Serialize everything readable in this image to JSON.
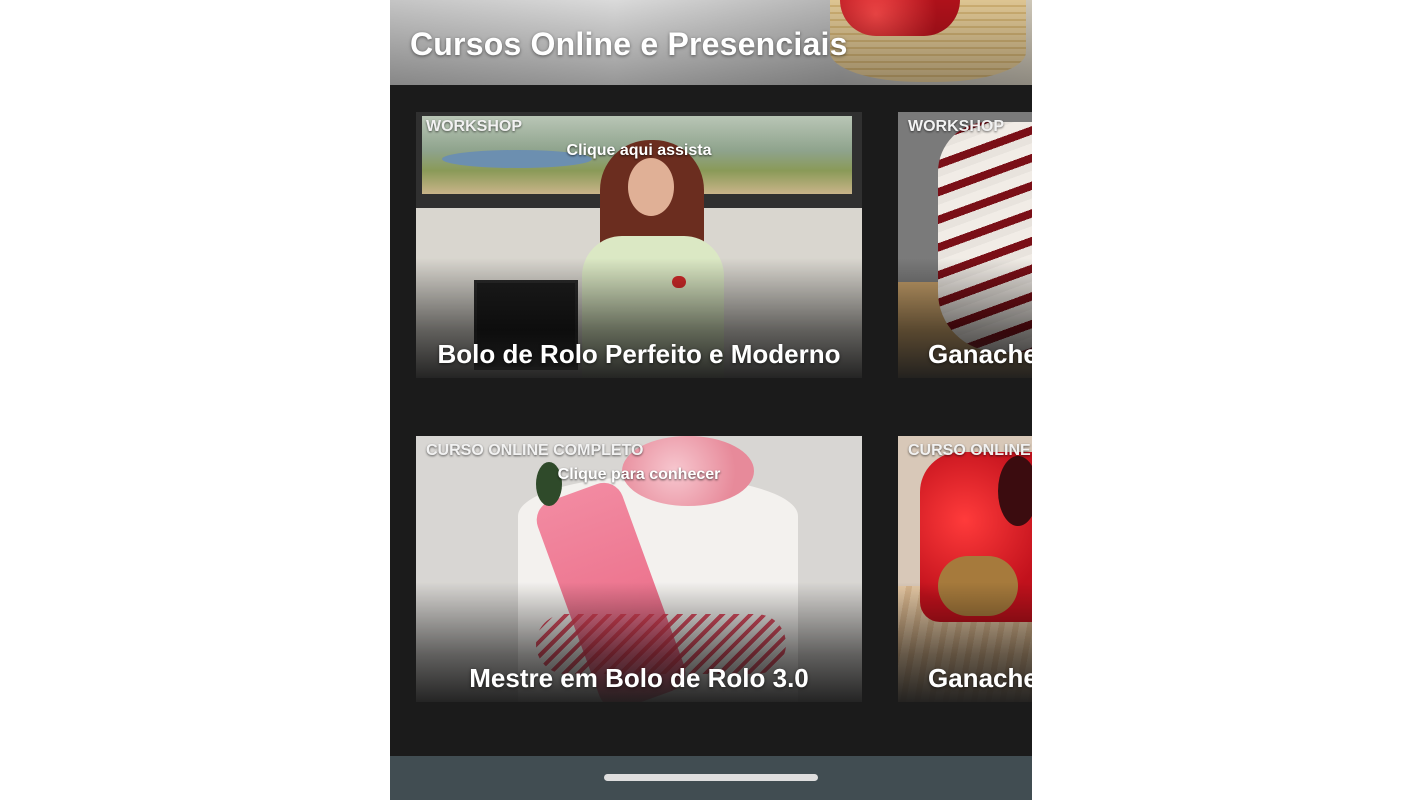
{
  "header": {
    "title": "Cursos Online e Presenciais"
  },
  "cards": [
    {
      "tag": "WORKSHOP",
      "cta": "Clique aqui assista",
      "title": "Bolo de Rolo Perfeito e Moderno"
    },
    {
      "tag": "WORKSHOP",
      "title": "Ganache"
    },
    {
      "tag": "CURSO ONLINE COMPLETO",
      "cta": "Clique para conhecer",
      "title": "Mestre em Bolo de Rolo 3.0"
    },
    {
      "tag": "CURSO ONLINE C",
      "title": "Ganache"
    }
  ],
  "colors": {
    "app_background": "#1b1b1b",
    "nav_bar": "#414d52",
    "text": "#ffffff"
  }
}
